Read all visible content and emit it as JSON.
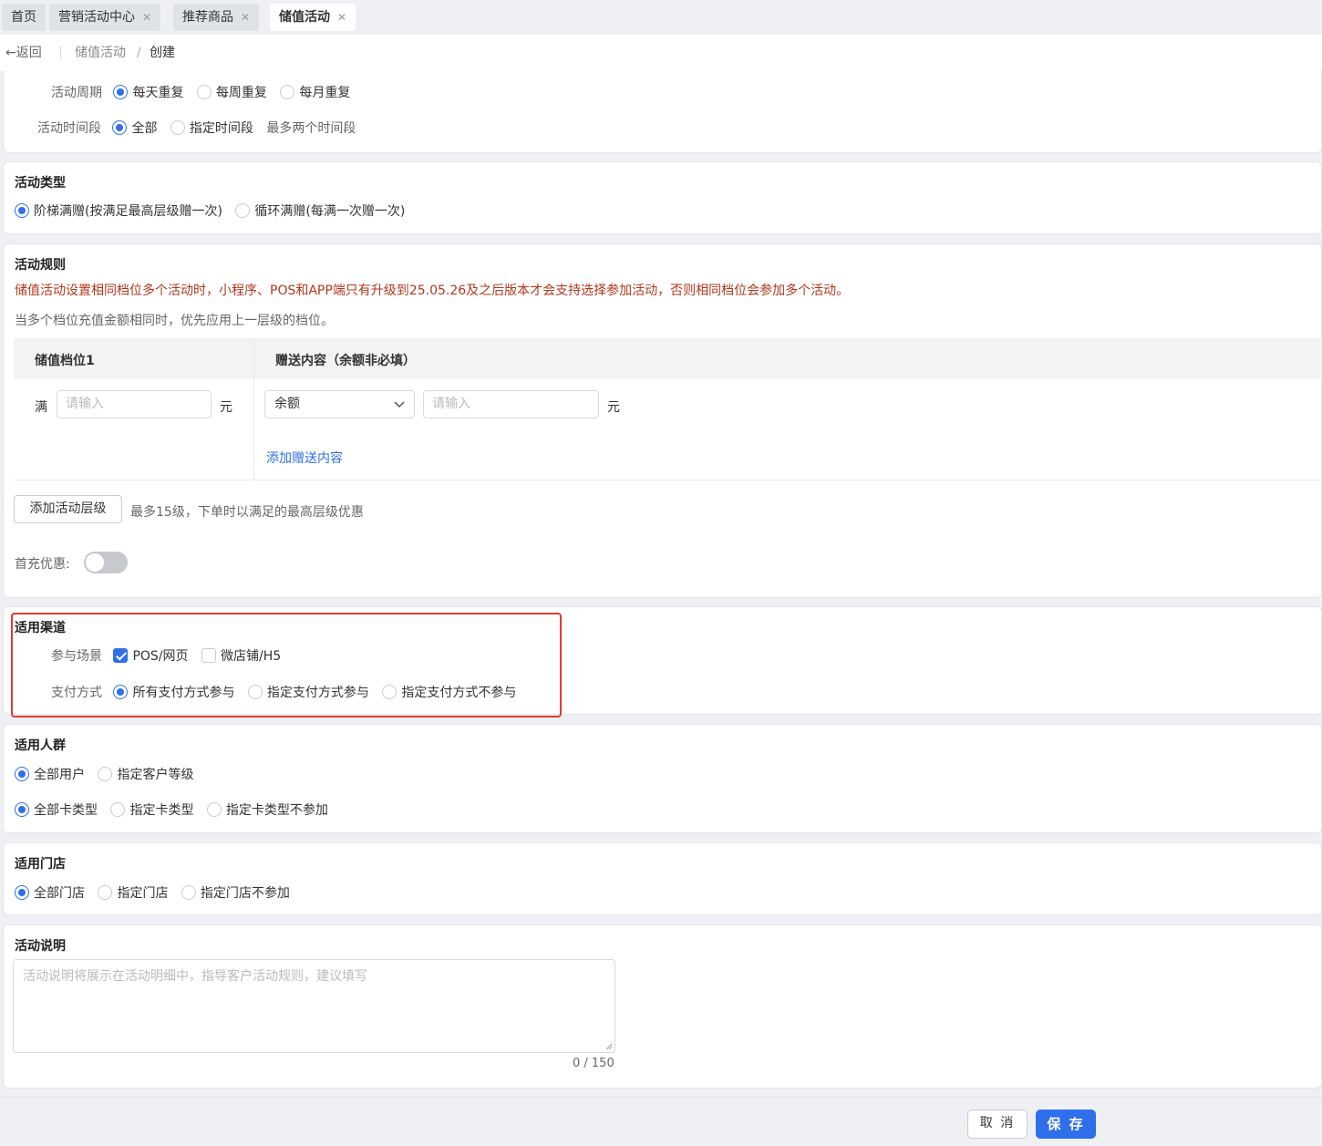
{
  "tabs": [
    {
      "label": "首页",
      "closable": false,
      "active": false
    },
    {
      "label": "营销活动中心",
      "closable": true,
      "active": false
    },
    {
      "label": "推荐商品",
      "closable": true,
      "active": false
    },
    {
      "label": "储值活动",
      "closable": true,
      "active": true
    }
  ],
  "breadcrumb": {
    "back": "返回",
    "parent": "储值活动",
    "separator": "/",
    "current": "创建"
  },
  "period": {
    "cycle_label": "活动周期",
    "cycle_options": [
      "每天重复",
      "每周重复",
      "每月重复"
    ],
    "cycle_selected": "每天重复",
    "time_label": "活动时间段",
    "time_options": [
      "全部",
      "指定时间段"
    ],
    "time_selected": "全部",
    "time_hint": "最多两个时间段"
  },
  "activity_type": {
    "title": "活动类型",
    "options": [
      "阶梯满赠(按满足最高层级赠一次)",
      "循环满赠(每满一次赠一次)"
    ],
    "selected": "阶梯满赠(按满足最高层级赠一次)"
  },
  "rules": {
    "title": "活动规则",
    "warning": "储值活动设置相同档位多个活动时，小程序、POS和APP端只有升级到25.05.26及之后版本才会支持选择参加活动，否则相同档位会参加多个活动。",
    "note": "当多个档位充值金额相同时，优先应用上一层级的档位。",
    "col1_header": "储值档位1",
    "col2_header": "赠送内容（余额非必填）",
    "full_label": "满",
    "amount_placeholder": "请输入",
    "unit": "元",
    "gift_type": "余额",
    "gift_placeholder": "请输入",
    "gift_unit": "元",
    "add_gift": "添加赠送内容",
    "add_level": "添加活动层级",
    "level_hint": "最多15级，下单时以满足的最高层级优惠",
    "first_charge_label": "首充优惠:",
    "first_charge_on": false
  },
  "channel": {
    "title": "适用渠道",
    "scene_label": "参与场景",
    "scene_options": [
      {
        "label": "POS/网页",
        "checked": true
      },
      {
        "label": "微店铺/H5",
        "checked": false
      }
    ],
    "pay_label": "支付方式",
    "pay_options": [
      "所有支付方式参与",
      "指定支付方式参与",
      "指定支付方式不参与"
    ],
    "pay_selected": "所有支付方式参与"
  },
  "audience": {
    "title": "适用人群",
    "user_options": [
      "全部用户",
      "指定客户等级"
    ],
    "user_selected": "全部用户",
    "card_options": [
      "全部卡类型",
      "指定卡类型",
      "指定卡类型不参加"
    ],
    "card_selected": "全部卡类型"
  },
  "stores": {
    "title": "适用门店",
    "options": [
      "全部门店",
      "指定门店",
      "指定门店不参加"
    ],
    "selected": "全部门店"
  },
  "description": {
    "title": "活动说明",
    "placeholder": "活动说明将展示在活动明细中，指导客户活动规则，建议填写",
    "counter": "0 / 150"
  },
  "footer": {
    "cancel": "取 消",
    "save": "保 存"
  },
  "colors": {
    "primary": "#2f6fea",
    "warning": "#b2361d",
    "highlight": "#e03c32"
  }
}
